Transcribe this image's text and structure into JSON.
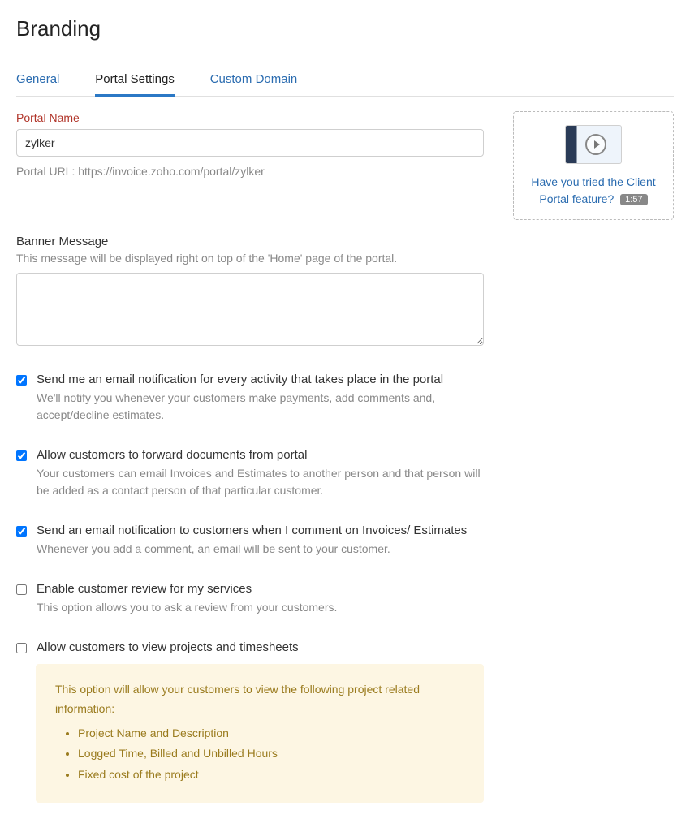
{
  "page_title": "Branding",
  "tabs": {
    "general": "General",
    "portal": "Portal Settings",
    "domain": "Custom Domain"
  },
  "portalName": {
    "label": "Portal Name",
    "value": "zylker"
  },
  "portalUrl": "Portal URL: https://invoice.zoho.com/portal/zylker",
  "banner": {
    "label": "Banner Message",
    "desc": "This message will be displayed right on top of the 'Home' page of the portal.",
    "value": ""
  },
  "options": {
    "emailActivity": {
      "title": "Send me an email notification for every activity that takes place in the portal",
      "desc": "We'll notify you whenever your customers make payments, add comments and, accept/decline estimates.",
      "checked": true
    },
    "forwardDocs": {
      "title": "Allow customers to forward documents from portal",
      "desc": "Your customers can email Invoices and Estimates to another person and that person will be added as a contact person of that particular customer.",
      "checked": true
    },
    "commentNotify": {
      "title": "Send an email notification to customers when I comment on Invoices/ Estimates",
      "desc": "Whenever you add a comment, an email will be sent to your customer.",
      "checked": true
    },
    "customerReview": {
      "title": "Enable customer review for my services",
      "desc": "This option allows you to ask a review from your customers.",
      "checked": false
    },
    "viewProjects": {
      "title": "Allow customers to view projects and timesheets",
      "checked": false,
      "infoIntro": "This option will allow your customers to view the following project related information:",
      "infoItems": {
        "i0": "Project Name and Description",
        "i1": "Logged Time, Billed and Unbilled Hours",
        "i2": "Fixed cost of the project"
      }
    }
  },
  "promo": {
    "text": "Have you tried the Client Portal feature?",
    "duration": "1:57"
  }
}
